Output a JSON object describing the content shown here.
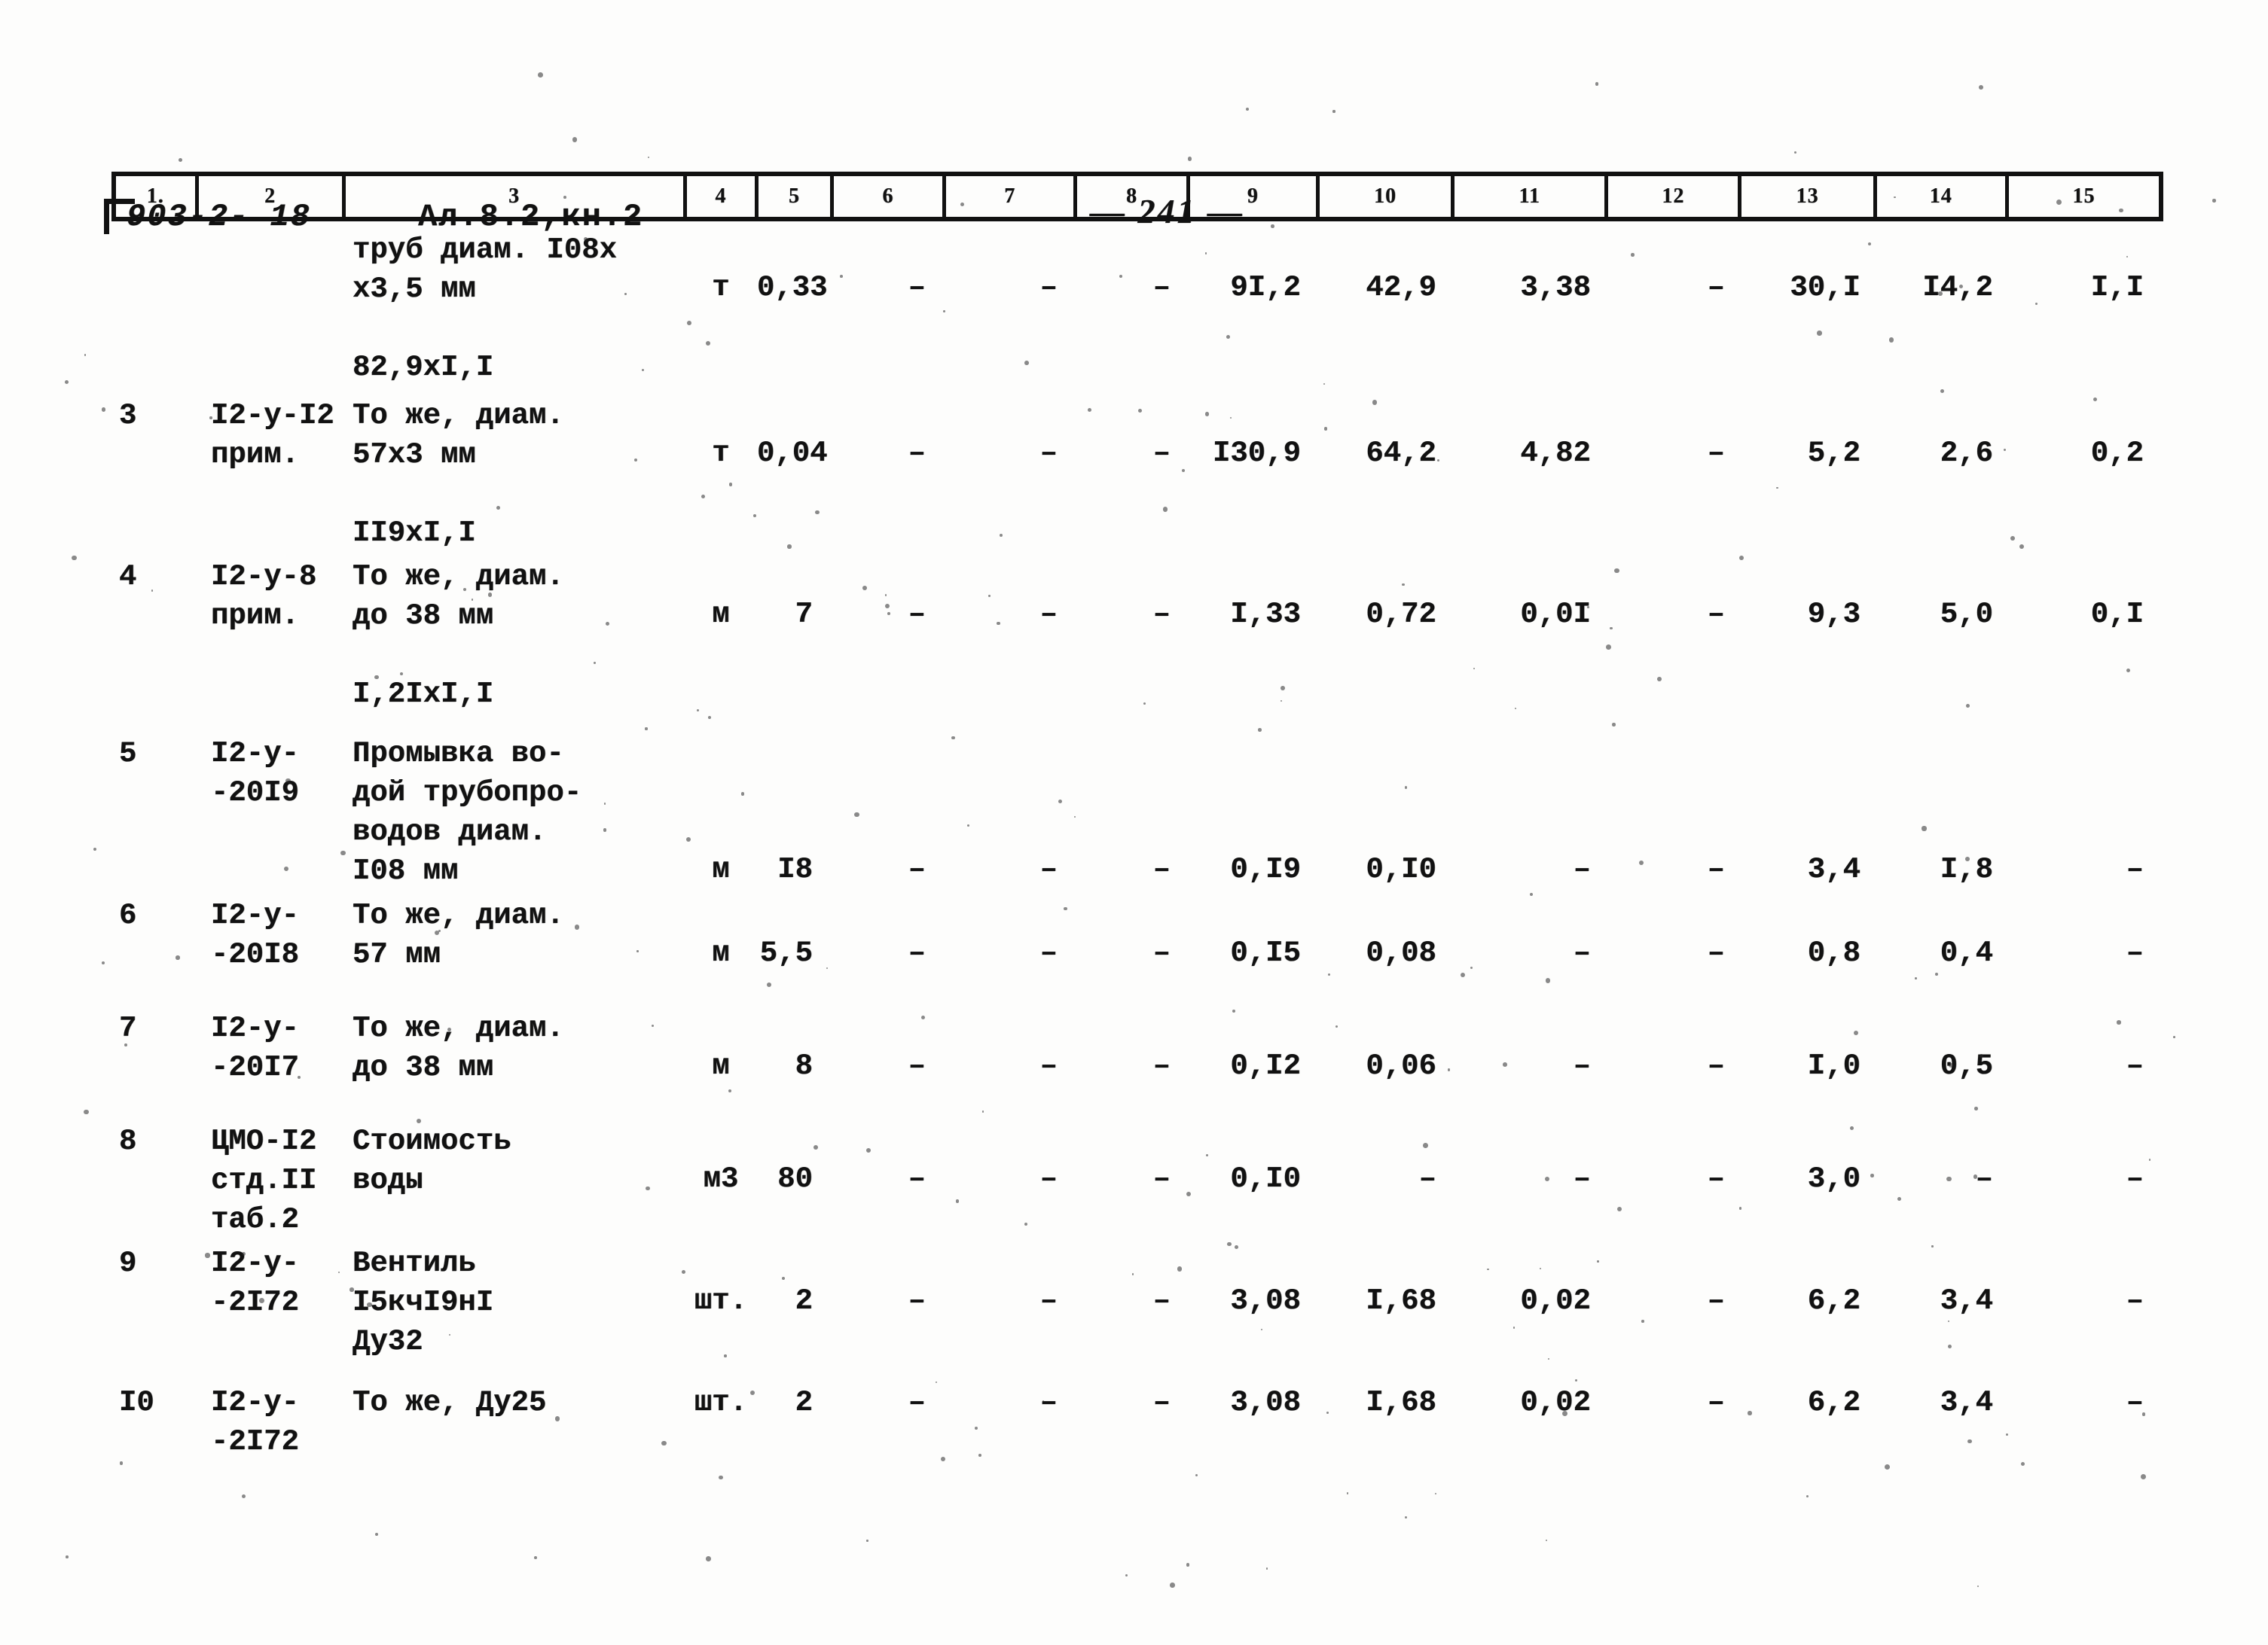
{
  "header": {
    "doc_code": "903-2- 18",
    "album": "Ал.8.2,кн.2",
    "page_number": "— 241 —"
  },
  "table": {
    "column_headers": [
      "1.",
      "2",
      "3",
      "4",
      "5",
      "6",
      "7",
      "8",
      "9",
      "10",
      "11",
      "12",
      "13",
      "14",
      "15"
    ],
    "rows": [
      {
        "num": "",
        "code": "",
        "description": "труб диам. I08х\nх3,5 мм\n\n82,9хI,I",
        "unit": "т",
        "c5": "0,33",
        "c6": "–",
        "c7": "–",
        "c8": "–",
        "c9": "9I,2",
        "c10": "42,9",
        "c11": "3,38",
        "c12": "–",
        "c13": "30,I",
        "c14": "I4,2",
        "c15": "I,I"
      },
      {
        "num": "3",
        "code": "I2-у-I2\nприм.",
        "description": "То же, диам.\n57х3 мм\n\nII9хI,I",
        "unit": "т",
        "c5": "0,04",
        "c6": "–",
        "c7": "–",
        "c8": "–",
        "c9": "I30,9",
        "c10": "64,2",
        "c11": "4,82",
        "c12": "–",
        "c13": "5,2",
        "c14": "2,6",
        "c15": "0,2"
      },
      {
        "num": "4",
        "code": "I2-у-8\nприм.",
        "description": "То же, диам.\nдо 38 мм\n\nI,2IхI,I",
        "unit": "м",
        "c5": "7",
        "c6": "–",
        "c7": "–",
        "c8": "–",
        "c9": "I,33",
        "c10": "0,72",
        "c11": "0,0I",
        "c12": "–",
        "c13": "9,3",
        "c14": "5,0",
        "c15": "0,I"
      },
      {
        "num": "5",
        "code": "I2-у-\n-20I9",
        "description": "Промывка во-\nдой трубопро-\nводов диам.\nI08 мм",
        "unit": "м",
        "c5": "I8",
        "c6": "–",
        "c7": "–",
        "c8": "–",
        "c9": "0,I9",
        "c10": "0,I0",
        "c11": "–",
        "c12": "–",
        "c13": "3,4",
        "c14": "I,8",
        "c15": "–"
      },
      {
        "num": "6",
        "code": "I2-у-\n-20I8",
        "description": "То же, диам.\n57 мм",
        "unit": "м",
        "c5": "5,5",
        "c6": "–",
        "c7": "–",
        "c8": "–",
        "c9": "0,I5",
        "c10": "0,08",
        "c11": "–",
        "c12": "–",
        "c13": "0,8",
        "c14": "0,4",
        "c15": "–"
      },
      {
        "num": "7",
        "code": "I2-у-\n-20I7",
        "description": "То же, диам.\nдо 38 мм",
        "unit": "м",
        "c5": "8",
        "c6": "–",
        "c7": "–",
        "c8": "–",
        "c9": "0,I2",
        "c10": "0,06",
        "c11": "–",
        "c12": "–",
        "c13": "I,0",
        "c14": "0,5",
        "c15": "–"
      },
      {
        "num": "8",
        "code": "ЦМО-I2\nстд.II\nтаб.2",
        "description": "Стоимость\nводы",
        "unit": "м3",
        "c5": "80",
        "c6": "–",
        "c7": "–",
        "c8": "–",
        "c9": "0,I0",
        "c10": "–",
        "c11": "–",
        "c12": "–",
        "c13": "3,0",
        "c14": "–",
        "c15": "–"
      },
      {
        "num": "9",
        "code": "I2-у-\n-2I72",
        "description": "Вентиль\nI5кчI9нI\nДу32",
        "unit": "шт.",
        "c5": "2",
        "c6": "–",
        "c7": "–",
        "c8": "–",
        "c9": "3,08",
        "c10": "I,68",
        "c11": "0,02",
        "c12": "–",
        "c13": "6,2",
        "c14": "3,4",
        "c15": "–"
      },
      {
        "num": "I0",
        "code": "I2-у-\n-2I72",
        "description": "То же, Ду25",
        "unit": "шт.",
        "c5": "2",
        "c6": "–",
        "c7": "–",
        "c8": "–",
        "c9": "3,08",
        "c10": "I,68",
        "c11": "0,02",
        "c12": "–",
        "c13": "6,2",
        "c14": "3,4",
        "c15": "–"
      }
    ]
  }
}
